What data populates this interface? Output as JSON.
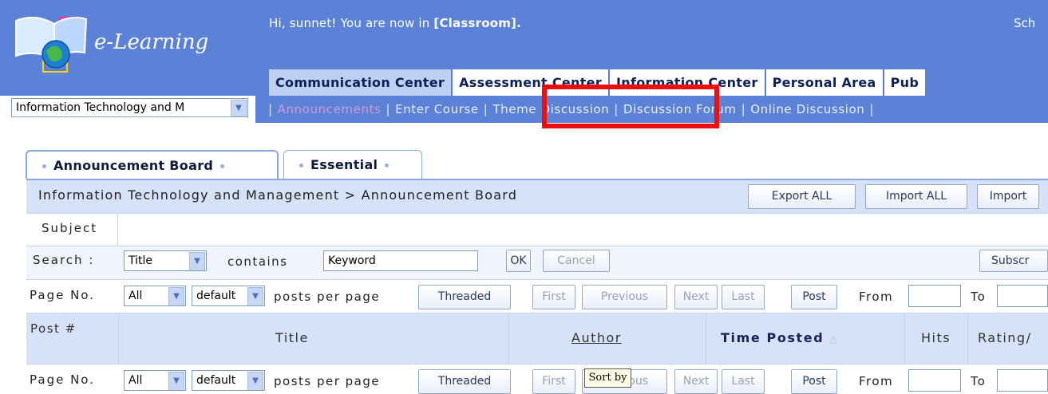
{
  "header": {
    "logo_text": "e-Learning",
    "greeting_prefix": "Hi, sunnet! You are now in ",
    "greeting_location": "[Classroom].",
    "cut_text": "Sch"
  },
  "main_tabs": [
    {
      "label": "Communication Center",
      "active": true
    },
    {
      "label": "Assessment Center",
      "active": false
    },
    {
      "label": "Information Center",
      "active": false
    },
    {
      "label": "Personal Area",
      "active": false
    },
    {
      "label": "Pub",
      "active": false
    }
  ],
  "course_select": {
    "value": "Information Technology and M"
  },
  "subnav": {
    "items": [
      "Announcements",
      "Enter Course",
      "Theme Discussion",
      "Discussion Forum",
      "Online Discussion"
    ],
    "active": "Announcements"
  },
  "board_tabs": [
    "Announcement Board",
    "Essential"
  ],
  "breadcrumb": "Information Technology and Management > Announcement Board",
  "toolbar": {
    "export_all": "Export ALL",
    "import_all": "Import ALL",
    "import": "Import"
  },
  "subject": {
    "label": "Subject"
  },
  "search": {
    "label": "Search :",
    "field": "Title",
    "contains": "contains",
    "keyword": "Keyword",
    "ok": "OK",
    "cancel": "Cancel",
    "subscribe": "Subscr"
  },
  "paging": {
    "label": "Page No.",
    "page_value": "All",
    "per_page_value": "default",
    "posts_per_page": "posts per page",
    "threaded": "Threaded",
    "first": "First",
    "previous": "Previous",
    "next": "Next",
    "last": "Last",
    "post": "Post",
    "from": "From",
    "to": "To"
  },
  "columns": {
    "post_no": "Post #",
    "title": "Title",
    "author": "Author",
    "time_posted": "Time Posted",
    "hits": "Hits",
    "rating": "Rating/"
  },
  "tooltip": "Sort by",
  "colors": {
    "header_blue": "#5b82d6",
    "highlight_red": "#ee0e0e",
    "table_blue": "#d5e2f7"
  }
}
